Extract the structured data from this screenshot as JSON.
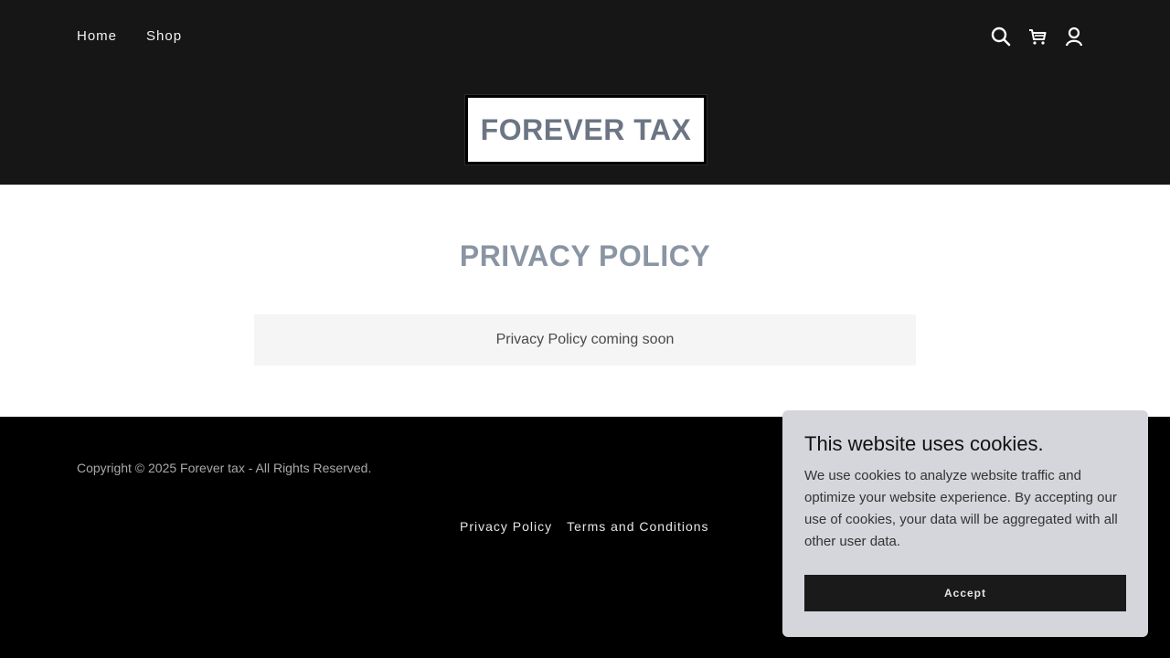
{
  "header": {
    "nav": [
      {
        "label": "Home"
      },
      {
        "label": "Shop"
      }
    ],
    "icons": [
      "search-icon",
      "cart-icon",
      "account-icon"
    ],
    "logo_text": "FOREVER TAX"
  },
  "main": {
    "title": "PRIVACY POLICY",
    "notice": "Privacy Policy coming soon"
  },
  "footer": {
    "copyright": "Copyright © 2025 Forever tax - All Rights Reserved.",
    "links": [
      {
        "label": "Privacy Policy"
      },
      {
        "label": "Terms and Conditions"
      }
    ]
  },
  "cookie_banner": {
    "title": "This website uses cookies.",
    "body": "We use cookies to analyze website traffic and optimize your website experience. By accepting our use of cookies, your data will be aggregated with all other user data.",
    "accept_label": "Accept"
  },
  "colors": {
    "header_bg": "#161616",
    "logo_text": "#6c7583",
    "title_text": "#8a95a3",
    "cookie_bg": "#d4d6db",
    "button_bg": "#1a1a1a"
  }
}
